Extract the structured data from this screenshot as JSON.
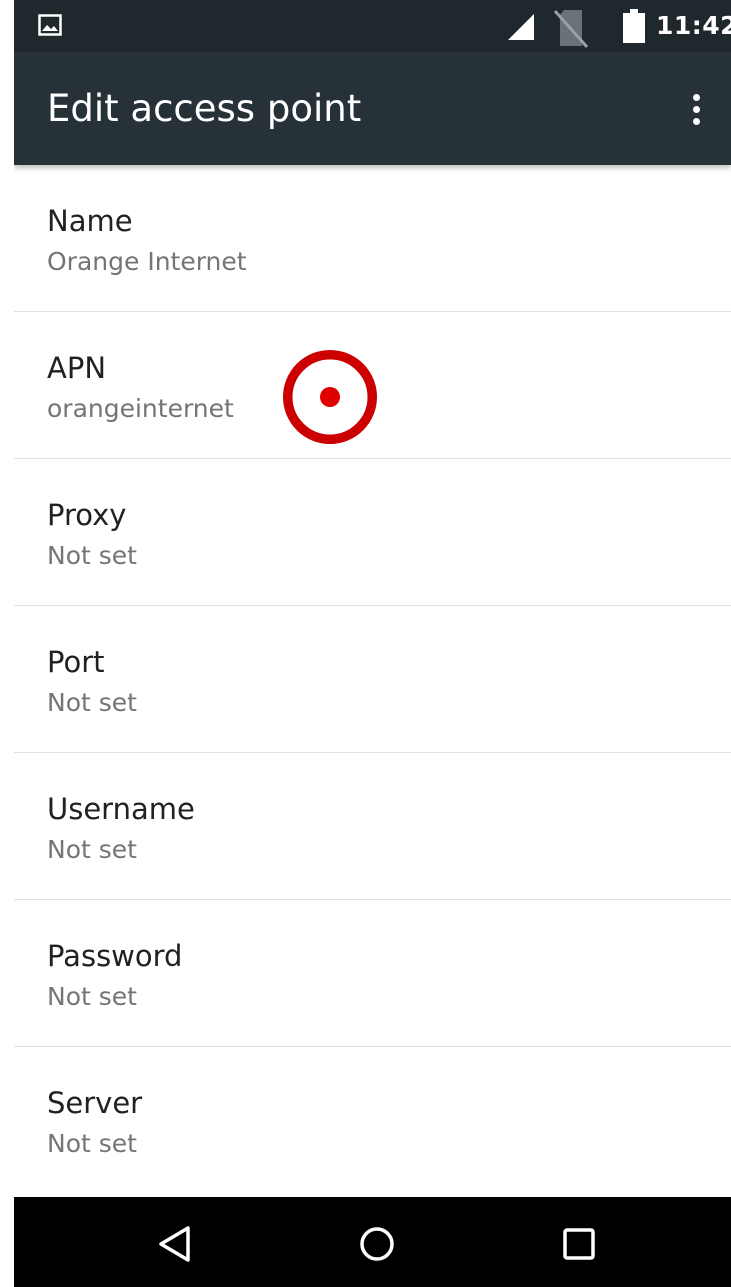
{
  "status_bar": {
    "time": "11:42",
    "icons": [
      "gallery-icon",
      "signal-icon",
      "no-sim-icon",
      "battery-icon"
    ]
  },
  "toolbar": {
    "title": "Edit access point",
    "overflow_icon": "more-vert-icon"
  },
  "preferences": [
    {
      "title": "Name",
      "summary": "Orange Internet"
    },
    {
      "title": "APN",
      "summary": "orangeinternet"
    },
    {
      "title": "Proxy",
      "summary": "Not set"
    },
    {
      "title": "Port",
      "summary": "Not set"
    },
    {
      "title": "Username",
      "summary": "Not set"
    },
    {
      "title": "Password",
      "summary": "Not set"
    },
    {
      "title": "Server",
      "summary": "Not set"
    }
  ],
  "nav_bar": {
    "icons": [
      "back-icon",
      "home-icon",
      "recents-icon"
    ]
  },
  "colors": {
    "status_bar_bg": "#1f282d",
    "toolbar_bg": "#263238",
    "title_text": "#212121",
    "summary_text": "#757575",
    "divider": "#e0e0e0",
    "touch_indicator": "#cc0000"
  }
}
